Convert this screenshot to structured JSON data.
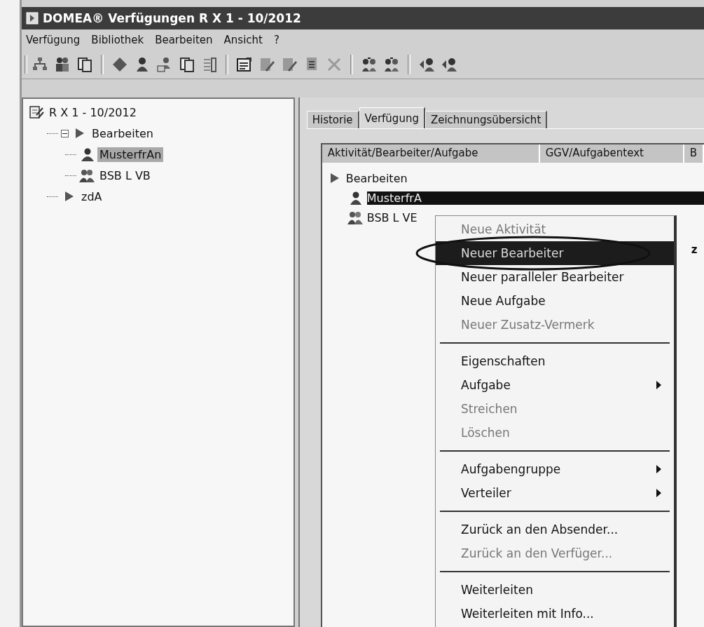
{
  "window": {
    "title": "DOMEA® Verfügungen R X 1 - 10/2012"
  },
  "menubar": [
    "Verfügung",
    "Bibliothek",
    "Bearbeiten",
    "Ansicht",
    "?"
  ],
  "tree": [
    {
      "label": "R X 1 - 10/2012",
      "kind": "dossier",
      "selected": false,
      "children": [
        {
          "label": "Bearbeiten",
          "kind": "step",
          "selected": false,
          "expanded": true,
          "children": [
            {
              "label": "MusterfrAn",
              "kind": "person",
              "selected": true
            },
            {
              "label": "BSB L VB",
              "kind": "group",
              "selected": false
            }
          ]
        },
        {
          "label": "zdA",
          "kind": "step",
          "selected": false
        }
      ]
    }
  ],
  "tabs": [
    {
      "label": "Historie",
      "selected": false
    },
    {
      "label": "Verfügung",
      "selected": true
    },
    {
      "label": "Zeichnungsübersicht",
      "selected": false
    }
  ],
  "columns": [
    "Aktivität/Bearbeiter/Aufgabe",
    "GGV/Aufgabentext",
    "B"
  ],
  "list": [
    {
      "label": "Bearbeiten",
      "kind": "step",
      "selected": false,
      "children": [
        {
          "label": "MusterfrA",
          "kind": "person",
          "selected": true
        },
        {
          "label": "BSB L VE",
          "kind": "group",
          "selected": false
        }
      ]
    }
  ],
  "column_2_text": "z",
  "context_menu": [
    {
      "kind": "item",
      "label": "Neue Aktivität",
      "disabled": true,
      "selected": false,
      "submenu": false,
      "circled": false
    },
    {
      "kind": "item",
      "label": "Neuer Bearbeiter",
      "disabled": false,
      "selected": true,
      "submenu": false,
      "circled": true
    },
    {
      "kind": "item",
      "label": "Neuer paralleler Bearbeiter",
      "disabled": false,
      "selected": false,
      "submenu": false,
      "circled": false
    },
    {
      "kind": "item",
      "label": "Neue Aufgabe",
      "disabled": false,
      "selected": false,
      "submenu": false,
      "circled": false
    },
    {
      "kind": "item",
      "label": "Neuer Zusatz-Vermerk",
      "disabled": true,
      "selected": false,
      "submenu": false,
      "circled": false
    },
    {
      "kind": "separator"
    },
    {
      "kind": "item",
      "label": "Eigenschaften",
      "disabled": false,
      "selected": false,
      "submenu": false,
      "circled": false
    },
    {
      "kind": "item",
      "label": "Aufgabe",
      "disabled": false,
      "selected": false,
      "submenu": true,
      "circled": false
    },
    {
      "kind": "item",
      "label": "Streichen",
      "disabled": true,
      "selected": false,
      "submenu": false,
      "circled": false
    },
    {
      "kind": "item",
      "label": "Löschen",
      "disabled": true,
      "selected": false,
      "submenu": false,
      "circled": false
    },
    {
      "kind": "separator"
    },
    {
      "kind": "item",
      "label": "Aufgabengruppe",
      "disabled": false,
      "selected": false,
      "submenu": true,
      "circled": false
    },
    {
      "kind": "item",
      "label": "Verteiler",
      "disabled": false,
      "selected": false,
      "submenu": true,
      "circled": false
    },
    {
      "kind": "separator"
    },
    {
      "kind": "item",
      "label": "Zurück an den Absender...",
      "disabled": false,
      "selected": false,
      "submenu": false,
      "circled": false
    },
    {
      "kind": "item",
      "label": "Zurück an den Verfüger...",
      "disabled": true,
      "selected": false,
      "submenu": false,
      "circled": false
    },
    {
      "kind": "separator"
    },
    {
      "kind": "item",
      "label": "Weiterleiten",
      "disabled": false,
      "selected": false,
      "submenu": false,
      "circled": false
    },
    {
      "kind": "item",
      "label": "Weiterleiten mit Info...",
      "disabled": false,
      "selected": false,
      "submenu": false,
      "circled": false
    }
  ]
}
